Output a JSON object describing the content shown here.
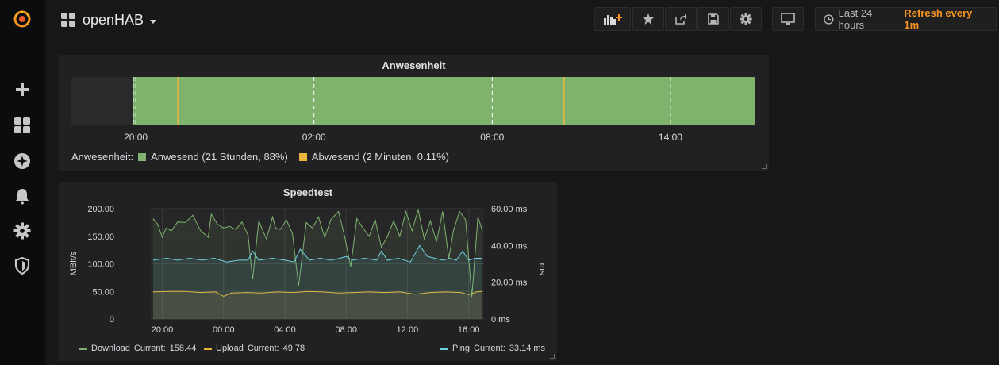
{
  "colors": {
    "accent": "#f79520",
    "green": "#7eb26d",
    "yellow": "#eab839",
    "cyan": "#6ed0e0",
    "orange": "#ef843c"
  },
  "sidebar": {
    "items": [
      {
        "name": "grafana-logo-icon"
      },
      {
        "name": "plus-icon"
      },
      {
        "name": "dashboards-icon"
      },
      {
        "name": "explore-compass-icon"
      },
      {
        "name": "alerting-bell-icon"
      },
      {
        "name": "configuration-gear-icon"
      },
      {
        "name": "shield-icon"
      }
    ]
  },
  "header": {
    "title": "openHAB",
    "time_range": "Last 24 hours",
    "refresh": "Refresh every 1m",
    "buttons": [
      "add-panel-icon",
      "star-icon",
      "share-icon",
      "save-icon",
      "settings-gear-icon",
      "tv-monitor-icon"
    ]
  },
  "anwesenheit": {
    "title": "Anwesenheit",
    "legend_prefix": "Anwesenheit:",
    "legend": [
      {
        "label": "Anwesend (21 Stunden, 88%)",
        "color": "#7eb26d"
      },
      {
        "label": "Abwesend (2 Minuten, 0.11%)",
        "color": "#eab839"
      }
    ]
  },
  "speedtest": {
    "title": "Speedtest",
    "legend": [
      {
        "name": "Download",
        "current_label": "Current:",
        "current": "158.44",
        "color": "#7eb26d"
      },
      {
        "name": "Upload",
        "current_label": "Current:",
        "current": "49.78",
        "color": "#eab839"
      },
      {
        "name": "Ping",
        "current_label": "Current:",
        "current": "33.14 ms",
        "color": "#6ed0e0"
      }
    ]
  },
  "chart_data": [
    {
      "type": "bar",
      "title": "Anwesenheit",
      "x_ticks": [
        "20:00",
        "02:00",
        "08:00",
        "14:00"
      ],
      "x_range": [
        "17:50",
        "16:50"
      ],
      "segments": [
        {
          "state": "no-data",
          "from": "17:50",
          "to": "19:55"
        },
        {
          "state": "Anwesend",
          "from": "19:55",
          "to": "16:50"
        }
      ],
      "markers": [
        {
          "state": "Abwesend",
          "at": "21:25"
        },
        {
          "state": "Abwesend",
          "at": "10:25"
        }
      ]
    },
    {
      "type": "line",
      "title": "Speedtest",
      "ylabel": "MBit/s",
      "ylabel_right": "ms",
      "yticks_left": [
        "0",
        "50.00",
        "100.00",
        "150.00",
        "200.00"
      ],
      "yticks_right": [
        "0 ms",
        "20.00 ms",
        "40.00 ms",
        "60.00 ms"
      ],
      "ylim": [
        0,
        200
      ],
      "ylim_right": [
        0,
        60
      ],
      "x_ticks": [
        "20:00",
        "00:00",
        "04:00",
        "08:00",
        "12:00",
        "16:00"
      ],
      "x_range": [
        -0.75,
        21
      ],
      "series": [
        {
          "name": "Download",
          "axis": "left",
          "color": "#7eb26d",
          "fill": true,
          "x": [
            -0.6,
            -0.3,
            0,
            0.25,
            0.6,
            1,
            1.5,
            2,
            2.5,
            3,
            3.2,
            3.6,
            4,
            4.4,
            4.8,
            5.2,
            5.6,
            5.9,
            6.3,
            6.8,
            7.2,
            7.4,
            7.7,
            8.1,
            8.5,
            8.9,
            9.4,
            9.8,
            10.2,
            10.6,
            11,
            11.5,
            11.9,
            12.3,
            12.7,
            13.1,
            13.5,
            13.9,
            14.3,
            14.7,
            15.1,
            15.5,
            15.9,
            16.3,
            16.7,
            17.1,
            17.5,
            17.9,
            18.3,
            18.7,
            19,
            19.4,
            19.8,
            20.2,
            20.6,
            20.9
          ],
          "y": [
            182,
            172,
            148,
            165,
            160,
            176,
            175,
            188,
            160,
            148,
            190,
            172,
            165,
            168,
            162,
            176,
            152,
            72,
            178,
            145,
            185,
            165,
            162,
            180,
            155,
            60,
            175,
            165,
            185,
            148,
            180,
            195,
            150,
            95,
            182,
            165,
            150,
            180,
            130,
            150,
            178,
            150,
            195,
            160,
            198,
            145,
            178,
            140,
            195,
            110,
            160,
            195,
            180,
            40,
            185,
            160
          ]
        },
        {
          "name": "Upload",
          "axis": "left",
          "color": "#eab839",
          "fill": true,
          "x": [
            -0.6,
            0.5,
            1.5,
            2.5,
            3.5,
            4,
            4.5,
            5.5,
            6.5,
            7.5,
            8.5,
            9.5,
            10.5,
            11.5,
            12.5,
            13.5,
            14.5,
            15.5,
            16.5,
            17.5,
            18.5,
            19.5,
            20,
            20.5,
            20.9
          ],
          "y": [
            49,
            50,
            50,
            48,
            49,
            41,
            47,
            48,
            47,
            49,
            48,
            50,
            49,
            47,
            48,
            49,
            48,
            49,
            45,
            48,
            49,
            48,
            44,
            49,
            50
          ]
        },
        {
          "name": "Ping",
          "axis": "right",
          "color": "#6ed0e0",
          "fill": true,
          "x": [
            -0.6,
            0.3,
            1,
            1.8,
            2.6,
            3.4,
            4.2,
            5,
            5.6,
            5.9,
            6.3,
            7.2,
            8,
            8.6,
            9,
            9.6,
            10.3,
            11,
            11.6,
            12,
            12.4,
            13.2,
            14,
            14.3,
            14.7,
            15.4,
            16.2,
            16.8,
            17.3,
            17.8,
            18.3,
            18.8,
            19.2,
            19.6,
            20,
            20.4,
            20.9
          ],
          "y": [
            32,
            33,
            32,
            33,
            32,
            33,
            31,
            32,
            32,
            37,
            32,
            33,
            32,
            31,
            38,
            32,
            33,
            32,
            33,
            34,
            32,
            33,
            32,
            37,
            32,
            33,
            31,
            40,
            34,
            33,
            32,
            33,
            32,
            37,
            32,
            33,
            33
          ]
        }
      ]
    }
  ]
}
